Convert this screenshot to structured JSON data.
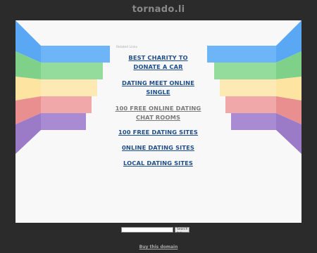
{
  "header": {
    "domain": "tornado.li"
  },
  "main": {
    "related_label": "Related Links",
    "links": [
      {
        "label": "BEST CHARITY TO DONATE A CAR",
        "visited": false
      },
      {
        "label": "DATING MEET ONLINE SINGLE",
        "visited": false
      },
      {
        "label": "100 FREE ONLINE DATING CHAT ROOMS",
        "visited": true
      },
      {
        "label": "100 FREE DATING SITES",
        "visited": false
      },
      {
        "label": "0NLINE DATING SITES",
        "visited": false
      },
      {
        "label": "LOCAL DATING SITES",
        "visited": false
      }
    ],
    "stripe_colors": [
      "#5aa7f3",
      "#7fd18a",
      "#fde4a0",
      "#f0a3a3",
      "#9b7bc8"
    ]
  },
  "footer": {
    "search_placeholder": "",
    "search_button": "Search Ads",
    "buy_link": "Buy this domain"
  }
}
